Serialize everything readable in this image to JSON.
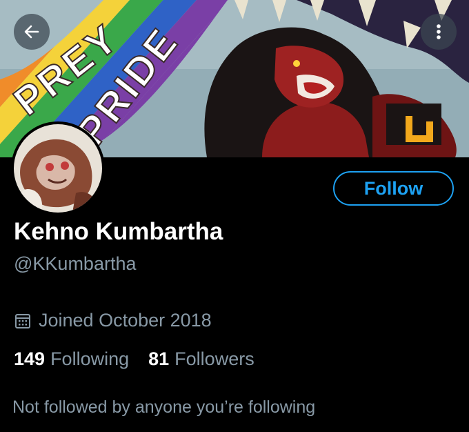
{
  "colors": {
    "accent": "#1da1f2",
    "secondary_text": "#8899a6",
    "background": "#000000"
  },
  "header": {
    "back_icon": "arrow-left-icon",
    "more_icon": "more-vertical-icon",
    "banner_text_1": "PREY",
    "banner_text_2": "PRIDE"
  },
  "profile": {
    "display_name": "Kehno Kumbartha",
    "handle": "@KKumbartha",
    "follow_label": "Follow",
    "joined_icon": "calendar-icon",
    "joined": "Joined October 2018",
    "following_count": "149",
    "following_label": "Following",
    "followers_count": "81",
    "followers_label": "Followers",
    "followed_by_note": "Not followed by anyone you’re following"
  }
}
